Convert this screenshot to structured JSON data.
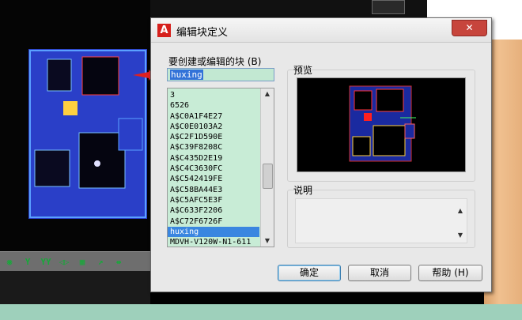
{
  "dialog": {
    "title": "编辑块定义",
    "app_icon": "A",
    "close_glyph": "✕",
    "block_label": "要创建或编辑的块 (B)",
    "block_value": "huxing",
    "preview_label": "预览",
    "description_label": "说明",
    "description_value": "",
    "list_items": [
      "3",
      "6526",
      "A$C0A1F4E27",
      "A$C0E0103A2",
      "A$C2F1D590E",
      "A$C39F8208C",
      "A$C435D2E19",
      "A$C4C3630FC",
      "A$C542419FE",
      "A$C58BA44E3",
      "A$C5AFC5E3F",
      "A$C633F2206",
      "A$C72F6726F",
      "huxing",
      "MDVH-V120W-N1-611"
    ],
    "selected_item": "huxing",
    "buttons": {
      "ok": "确定",
      "cancel": "取消",
      "help": "帮助 (H)"
    }
  },
  "toolbar": {
    "icons": [
      "snap-icon",
      "y-icon",
      "yy-icon",
      "mirror-icon",
      "grid-icon",
      "pin-icon",
      "measure-icon"
    ],
    "glyphs": [
      "◉",
      "Y",
      "YY",
      "◁▷",
      "▦",
      "↗",
      "⇹"
    ]
  },
  "colors": {
    "canvas": "#000000",
    "list_bg": "#c8ecd6",
    "selection": "#3a86e0",
    "close_button": "#c7453c",
    "plan_walls": "#3a4fd8"
  }
}
